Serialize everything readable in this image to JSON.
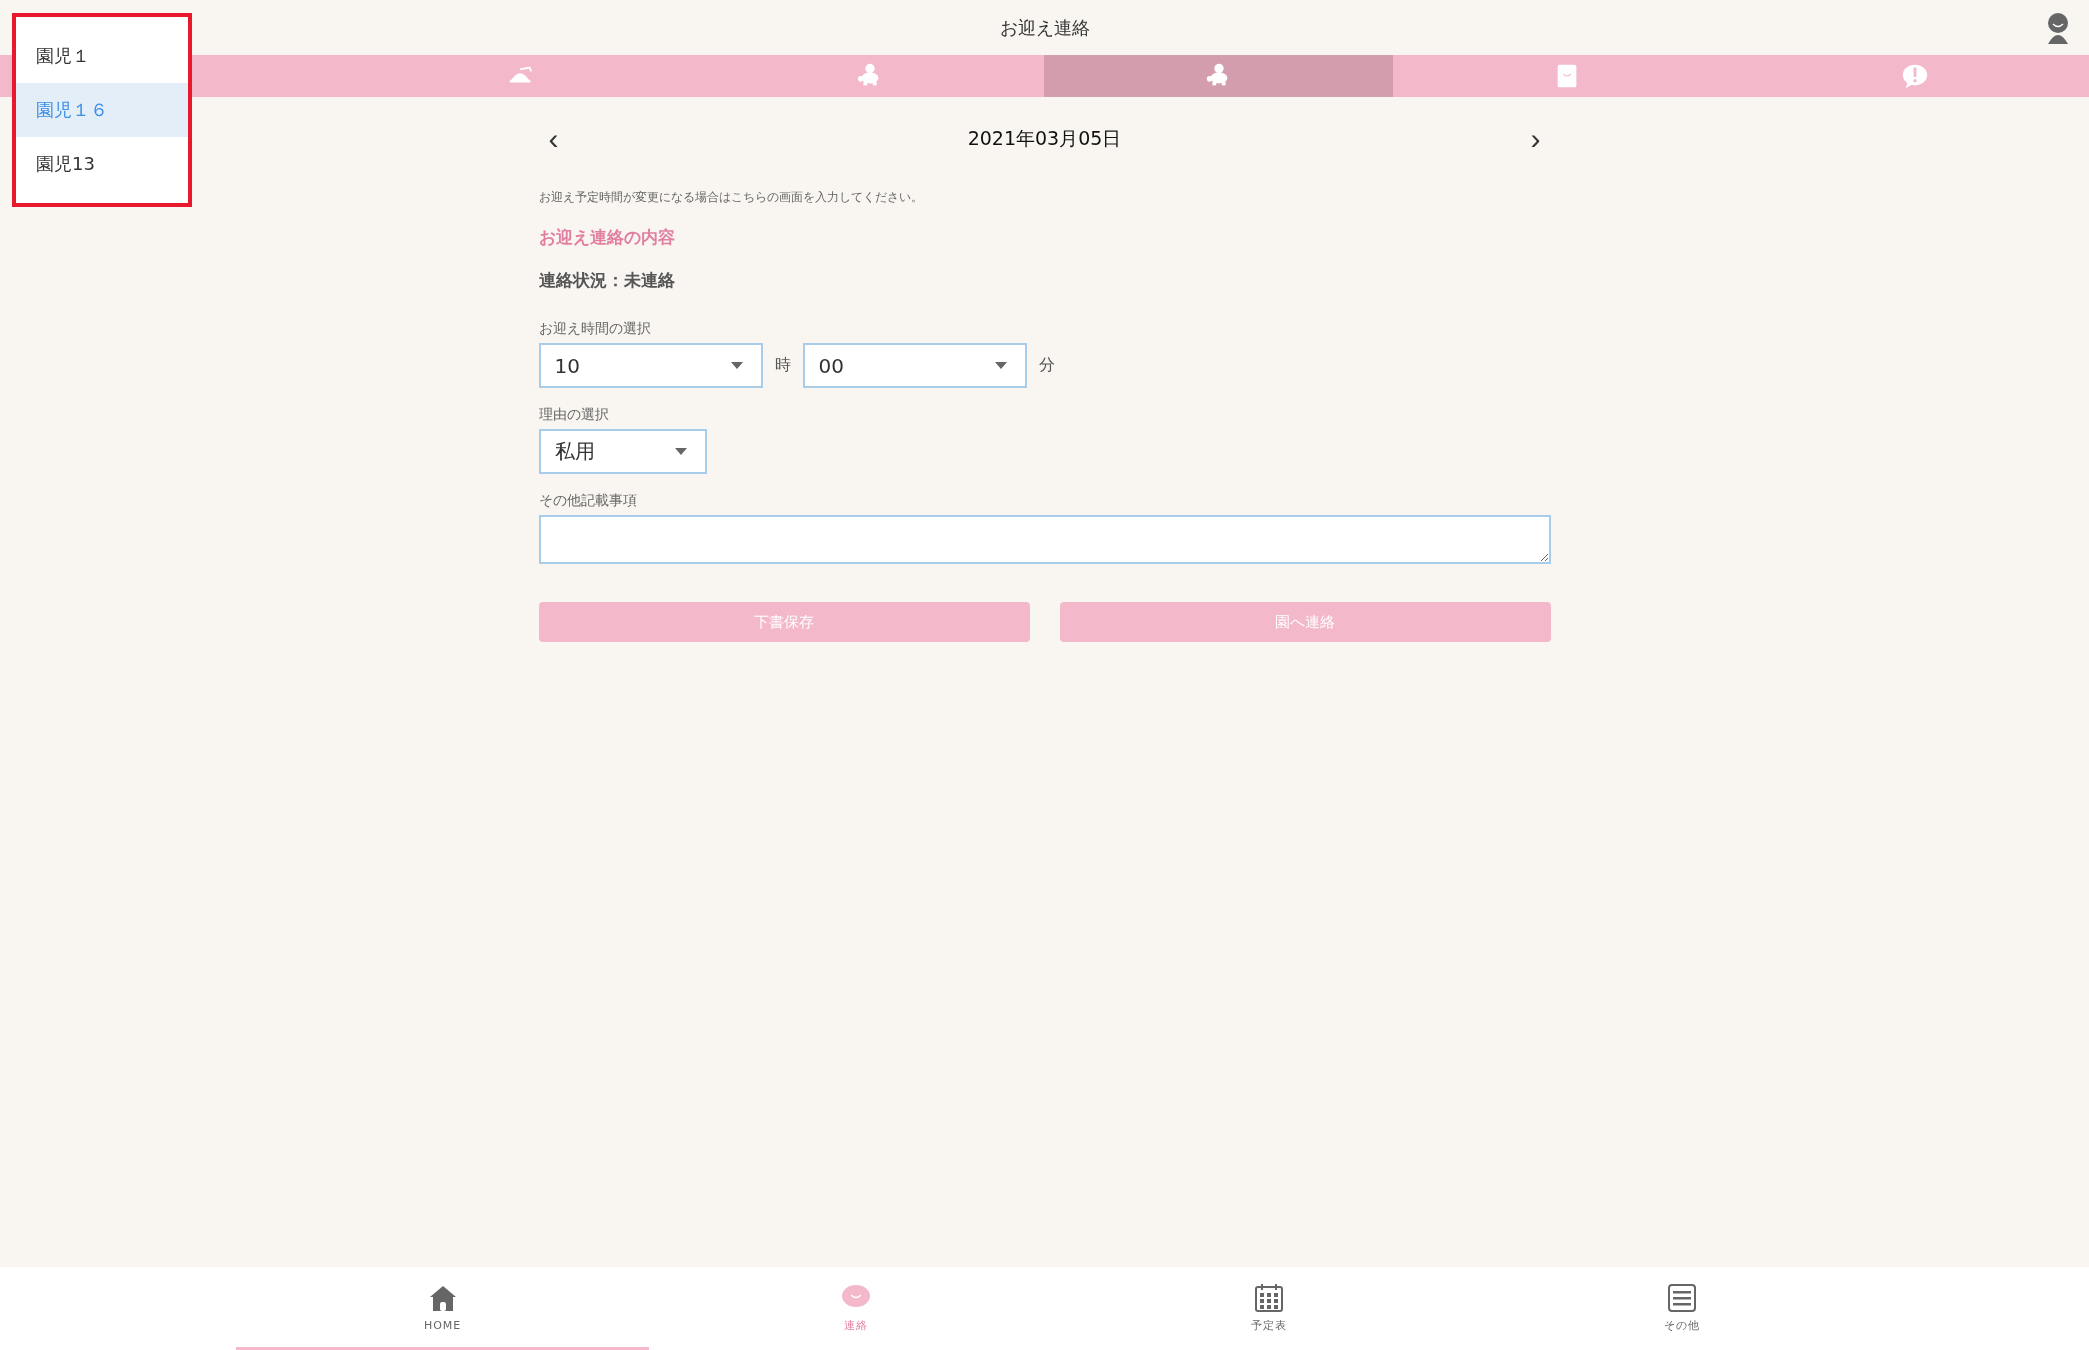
{
  "header": {
    "title": "お迎え連絡"
  },
  "tabs": [
    {
      "selected": false
    },
    {
      "selected": false
    },
    {
      "selected": true
    },
    {
      "selected": false
    },
    {
      "selected": false
    }
  ],
  "child_dropdown": {
    "options": [
      {
        "label": "園児１",
        "selected": false
      },
      {
        "label": "園児１６",
        "selected": true
      },
      {
        "label": "園児13",
        "selected": false
      }
    ]
  },
  "date_nav": {
    "prev": "‹",
    "date": "2021年03月05日",
    "next": "›"
  },
  "description": "お迎え予定時間が変更になる場合はこちらの画面を入力してください。",
  "section_title": "お迎え連絡の内容",
  "status": "連絡状況：未連絡",
  "time": {
    "label": "お迎え時間の選択",
    "hour": "10",
    "hour_unit": "時",
    "minute": "00",
    "minute_unit": "分"
  },
  "reason": {
    "label": "理由の選択",
    "value": "私用"
  },
  "notes": {
    "label": "その他記載事項"
  },
  "buttons": [
    "下書保存",
    "園へ連絡"
  ],
  "bottom_nav": [
    {
      "label": "HOME",
      "selected": true,
      "active": false
    },
    {
      "label": "連絡",
      "selected": false,
      "active": true
    },
    {
      "label": "予定表",
      "selected": false,
      "active": false
    },
    {
      "label": "その他",
      "selected": false,
      "active": false
    }
  ]
}
